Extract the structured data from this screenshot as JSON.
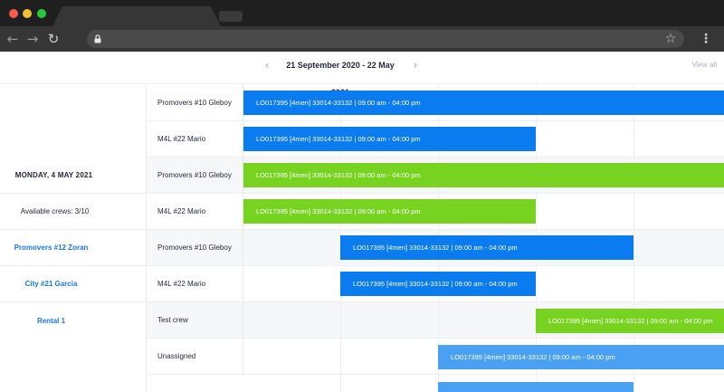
{
  "browser": {
    "back_icon": "arrow-left-icon",
    "forward_icon": "arrow-right-icon",
    "reload_icon": "reload-icon",
    "lock_icon": "lock-icon",
    "star_icon": "star-icon",
    "menu_icon": "vertical-dots-icon",
    "back_glyph": "←",
    "forward_glyph": "→",
    "reload_glyph": "↻",
    "star_glyph": "☆",
    "menu_glyph": "⋮"
  },
  "header": {
    "date_range": "21 September 2020 - 22 May 2021",
    "prev_glyph": "‹",
    "next_glyph": "›",
    "view_all": "View all"
  },
  "sidebar": {
    "date": "MONDAY, 4 MAY 2021",
    "available": "Available crews: 3/10",
    "crews": [
      "Promovers #12 Zoran",
      "City #21 Garcia",
      "Rental 1"
    ]
  },
  "rows": [
    {
      "crew": "Promovers #10 Gleboy",
      "bar": "LO017395 [4men] 33014-33132 | 09:00 am - 04:00 pm",
      "color": "#0a7cf0"
    },
    {
      "crew": "M4L #22 Mario",
      "bar": "LO017395 [4men] 33014-33132 | 09:00 am - 04:00 pm",
      "color": "#0a7cf0"
    },
    {
      "crew": "Promovers #10 Gleboy",
      "bar": "LO017395 [4men] 33014-33132 | 09:00 am - 04:00 pm",
      "color": "#78d321"
    },
    {
      "crew": "M4L #22 Mario",
      "bar": "LO017395 [4men] 33014-33132 | 09:00 am - 04:00 pm",
      "color": "#78d321"
    },
    {
      "crew": "Promovers #10 Gleboy",
      "bar": "LO017395 [4men] 33014-33132 | 09:00 am - 04:00 pm",
      "color": "#0a7cf0"
    },
    {
      "crew": "M4L #22 Mario",
      "bar": "LO017395 [4men] 33014-33132 | 09:00 am - 04:00 pm",
      "color": "#0a7cf0"
    },
    {
      "crew": "Test crew",
      "bar": "LO017395 [4men] 33014-33132 | 09:00 am - 04:00 pm",
      "color": "#78d321"
    },
    {
      "crew": "Unassigned",
      "bar": "LO017395 [4men] 33014-33132 | 09:00 am - 04:00 pm",
      "color": "#4aa0f2"
    }
  ]
}
